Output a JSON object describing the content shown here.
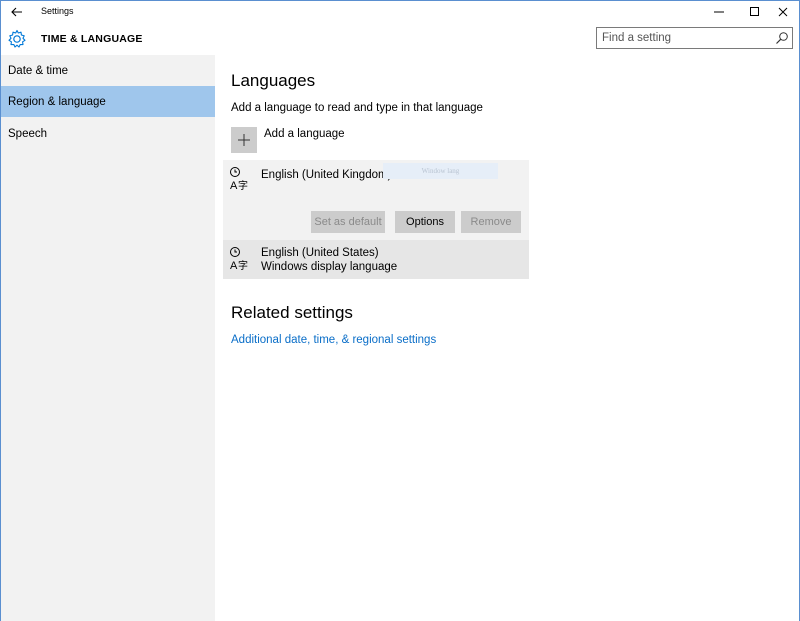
{
  "window": {
    "title": "Settings"
  },
  "header": {
    "title": "TIME & LANGUAGE",
    "search_placeholder": "Find a setting"
  },
  "sidebar": {
    "items": [
      {
        "label": "Date & time",
        "selected": false
      },
      {
        "label": "Region & language",
        "selected": true
      },
      {
        "label": "Speech",
        "selected": false
      }
    ]
  },
  "main": {
    "languages_heading": "Languages",
    "languages_description": "Add a language to read and type in that language",
    "add_language_label": "Add a language",
    "languages": [
      {
        "name": "English (United Kingdom)",
        "subtitle": "",
        "ghost_tag": "Window lang",
        "buttons": {
          "set_default": "Set as default",
          "options": "Options",
          "remove": "Remove"
        }
      },
      {
        "name": "English (United States)",
        "subtitle": "Windows display language"
      }
    ],
    "related_heading": "Related settings",
    "related_link": "Additional date, time, & regional settings"
  },
  "colors": {
    "sidebar_bg": "#f2f2f2",
    "selected_bg": "#9fc6ec",
    "link": "#0a6ec8",
    "accent": "#0078d7",
    "button_bg": "#cccccc"
  },
  "icons": {
    "back": "back-arrow-icon",
    "app": "gear-icon",
    "search": "search-icon",
    "language": "language-time-icon",
    "add": "plus-icon"
  }
}
